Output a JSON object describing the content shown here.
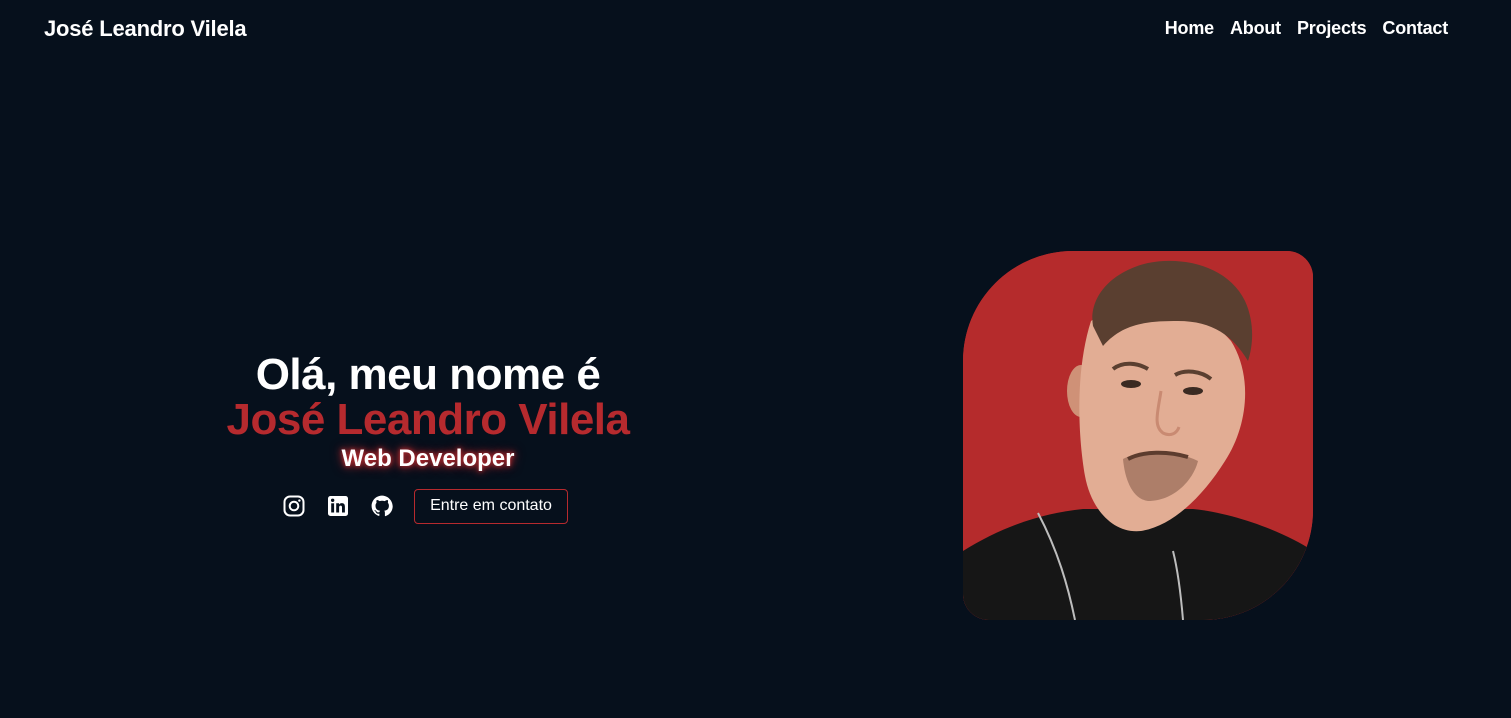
{
  "header": {
    "brand": "José Leandro Vilela",
    "nav": [
      {
        "label": "Home"
      },
      {
        "label": "About"
      },
      {
        "label": "Projects"
      },
      {
        "label": "Contact"
      }
    ]
  },
  "hero": {
    "greeting": "Olá, meu nome é",
    "name": "José Leandro Vilela",
    "role": "Web Developer",
    "contact_button": "Entre em contato",
    "socials": [
      {
        "icon": "instagram-icon"
      },
      {
        "icon": "linkedin-icon"
      },
      {
        "icon": "github-icon"
      }
    ]
  },
  "colors": {
    "background": "#06101c",
    "accent": "#b62a2e",
    "text": "#ffffff"
  }
}
